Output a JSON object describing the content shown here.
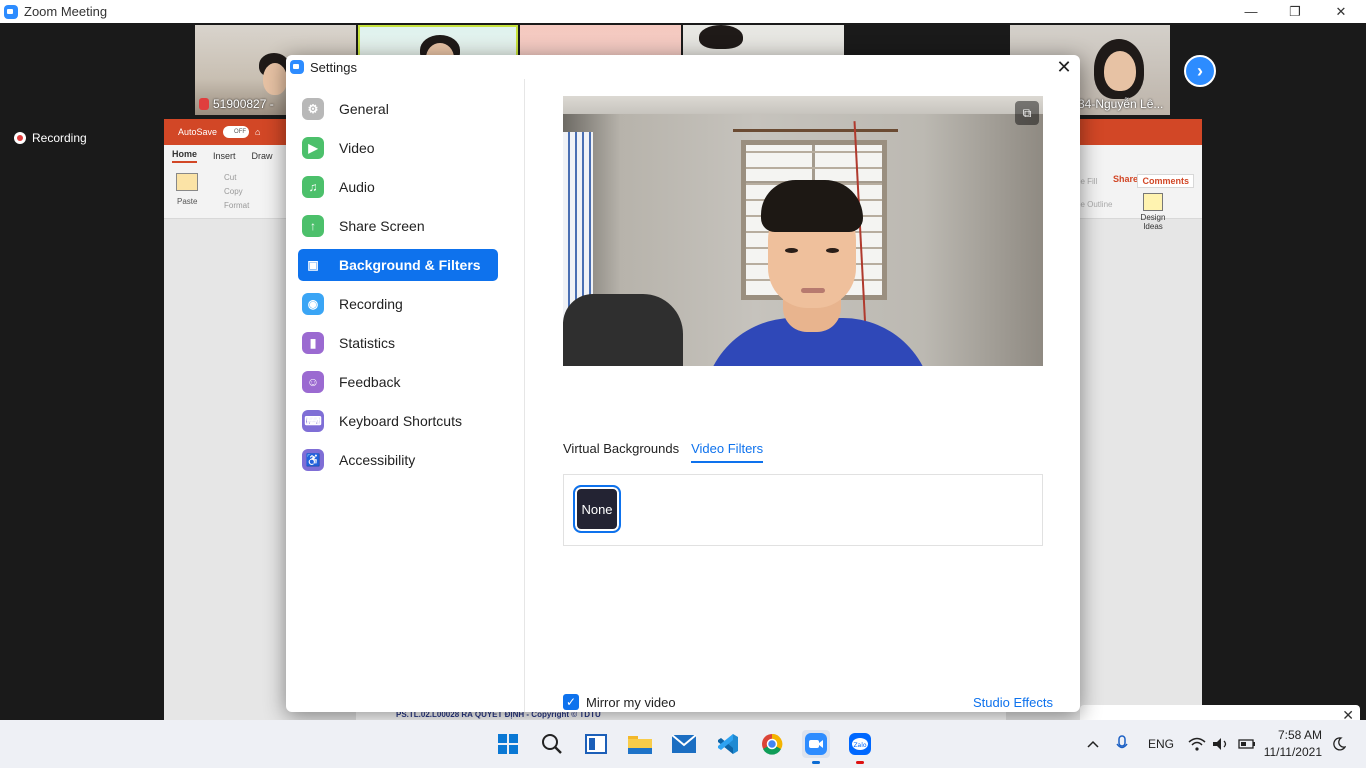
{
  "window": {
    "title": "Zoom Meeting",
    "minimize": "—",
    "restore": "❐",
    "close": "✕"
  },
  "gallery": {
    "tiles": [
      {
        "name": "51900827 -"
      },
      {
        "name": ""
      },
      {
        "name": ""
      },
      {
        "name": ""
      },
      {
        "name": "34-Nguyễn Lê..."
      }
    ],
    "next_icon": "›"
  },
  "recording_badge": "Recording",
  "ppt": {
    "autosave": "AutoSave",
    "autosave_state": "OFF",
    "tabs": [
      "Home",
      "Insert",
      "Draw"
    ],
    "clipboard": {
      "paste": "Paste",
      "cut": "Cut",
      "copy": "Copy",
      "format": "Format"
    },
    "share": "Share",
    "comments": "Comments",
    "shape_fill": "pe Fill",
    "shape_outline": "pe Outline",
    "design_ideas": "Design Ideas",
    "footer": "PS.TL.02.L00028 RA QUYẾT ĐỊNH - Copyright © TDTU"
  },
  "settings": {
    "title": "Settings",
    "close_icon": "✕",
    "nav": [
      {
        "label": "General",
        "color": "#b8b8b8",
        "glyph": "⚙"
      },
      {
        "label": "Video",
        "color": "#4cc06b",
        "glyph": "▶"
      },
      {
        "label": "Audio",
        "color": "#4cc06b",
        "glyph": "♫"
      },
      {
        "label": "Share Screen",
        "color": "#4cc06b",
        "glyph": "↑"
      },
      {
        "label": "Background & Filters",
        "color": "#0e72ed",
        "glyph": "▣"
      },
      {
        "label": "Recording",
        "color": "#3aa5f5",
        "glyph": "◉"
      },
      {
        "label": "Statistics",
        "color": "#9b6ad1",
        "glyph": "▮"
      },
      {
        "label": "Feedback",
        "color": "#9b6ad1",
        "glyph": "☺"
      },
      {
        "label": "Keyboard Shortcuts",
        "color": "#7f6ed6",
        "glyph": "⌨"
      },
      {
        "label": "Accessibility",
        "color": "#7f6ed6",
        "glyph": "♿"
      }
    ],
    "tabs": [
      {
        "label": "Virtual Backgrounds"
      },
      {
        "label": "Video Filters"
      }
    ],
    "filter_none": "None",
    "mirror_label": "Mirror my video",
    "mirror_checked": "✓",
    "studio_effects": "Studio Effects"
  },
  "chat_popup": {
    "text": "💞🖤❣🖤💞",
    "close": "✕"
  },
  "taskbar": {
    "language": "ENG",
    "time": "7:58 AM",
    "date": "11/11/2021"
  }
}
